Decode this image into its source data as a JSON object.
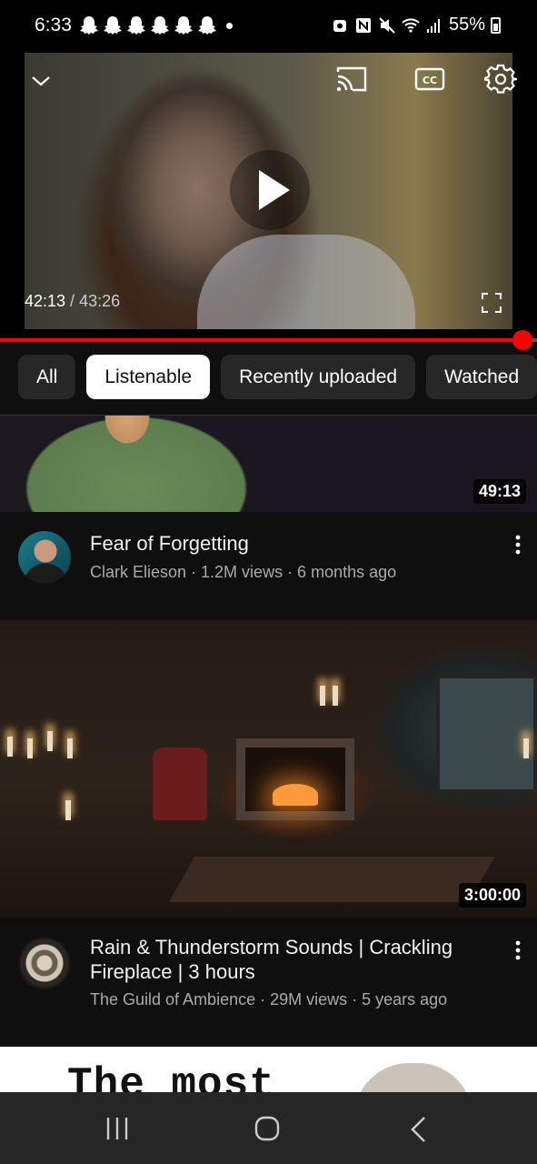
{
  "status_bar": {
    "time": "6:33",
    "battery": "55%",
    "icons": [
      "snapchat-icon",
      "snapchat-icon",
      "snapchat-icon",
      "snapchat-icon",
      "snapchat-icon",
      "snapchat-icon",
      "nfc-icon",
      "mute-icon",
      "wifi-icon",
      "signal-icon",
      "battery-icon"
    ]
  },
  "player": {
    "current_time": "42:13",
    "separator": " / ",
    "duration": "43:26",
    "progress": 0.973,
    "accent": "#ff0000"
  },
  "chips": [
    {
      "label": "All",
      "active": false
    },
    {
      "label": "Listenable",
      "active": true
    },
    {
      "label": "Recently uploaded",
      "active": false
    },
    {
      "label": "Watched",
      "active": false
    }
  ],
  "videos": [
    {
      "duration": "49:13",
      "title": "Fear of Forgetting",
      "channel_line": "Clark Elieson · 1.2M views · 6 months ago"
    },
    {
      "duration": "3:00:00",
      "title": "Rain & Thunderstorm Sounds | Crackling Fireplace | 3 hours",
      "channel_line": "The Guild of Ambience · 29M views · 5 years ago"
    },
    {
      "thumb_text": "The most"
    }
  ]
}
